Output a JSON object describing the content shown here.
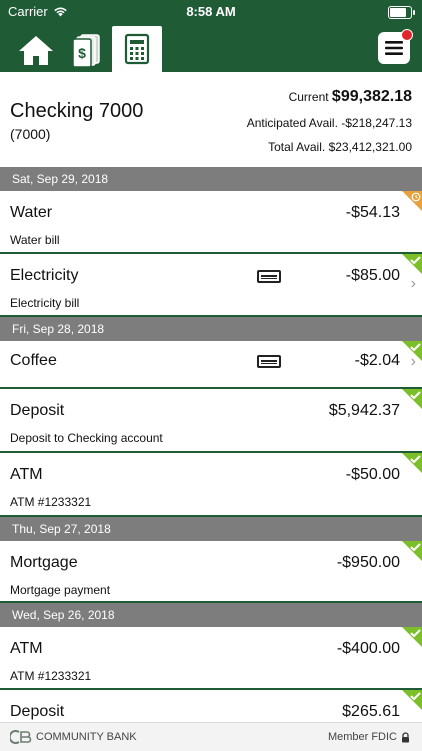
{
  "status_bar": {
    "carrier": "Carrier",
    "time": "8:58 AM",
    "battery_level": 0.9
  },
  "navbar": {
    "tabs": [
      {
        "name": "home",
        "icon": "home-icon"
      },
      {
        "name": "money",
        "icon": "money-icon"
      },
      {
        "name": "register",
        "icon": "register-icon",
        "active": true
      }
    ],
    "menu_icon": "hamburger-icon",
    "colors": {
      "brand": "#1f5c36",
      "badge": "#e0252a",
      "cleared": "#7cbf2a",
      "pending": "#e9a23b",
      "header": "#7d7d7d"
    }
  },
  "account": {
    "name": "Checking 7000",
    "number": "(7000)",
    "current_label": "Current",
    "current_value": "$99,382.18",
    "anticipated_label": "Anticipated Avail.",
    "anticipated_value": "-$218,247.13",
    "total_label": "Total Avail.",
    "total_value": "$23,412,321.00"
  },
  "dates": [
    "Sat, Sep 29, 2018",
    "Fri, Sep 28, 2018",
    "Thu, Sep 27, 2018",
    "Wed, Sep 26, 2018"
  ],
  "transactions": [
    {
      "title": "Water",
      "desc": "Water bill",
      "amount": "-$54.13",
      "status": "pending"
    },
    {
      "title": "Electricity",
      "desc": "Electricity bill",
      "amount": "-$85.00",
      "status": "cleared",
      "card": true,
      "chevron": true
    },
    {
      "title": "Coffee",
      "desc": "",
      "amount": "-$2.04",
      "status": "cleared",
      "card": true,
      "chevron": true
    },
    {
      "title": "Deposit",
      "desc": "Deposit to Checking account",
      "amount": "$5,942.37",
      "status": "cleared"
    },
    {
      "title": "ATM",
      "desc": "ATM #1233321",
      "amount": "-$50.00",
      "status": "cleared"
    },
    {
      "title": "Mortgage",
      "desc": "Mortgage payment",
      "amount": "-$950.00",
      "status": "cleared"
    },
    {
      "title": "ATM",
      "desc": "ATM #1233321",
      "amount": "-$400.00",
      "status": "cleared"
    },
    {
      "title": "Deposit",
      "desc": "",
      "amount": "$265.61",
      "status": "cleared"
    }
  ],
  "footer": {
    "bank_name": "COMMUNITY BANK",
    "fdic": "Member FDIC"
  }
}
